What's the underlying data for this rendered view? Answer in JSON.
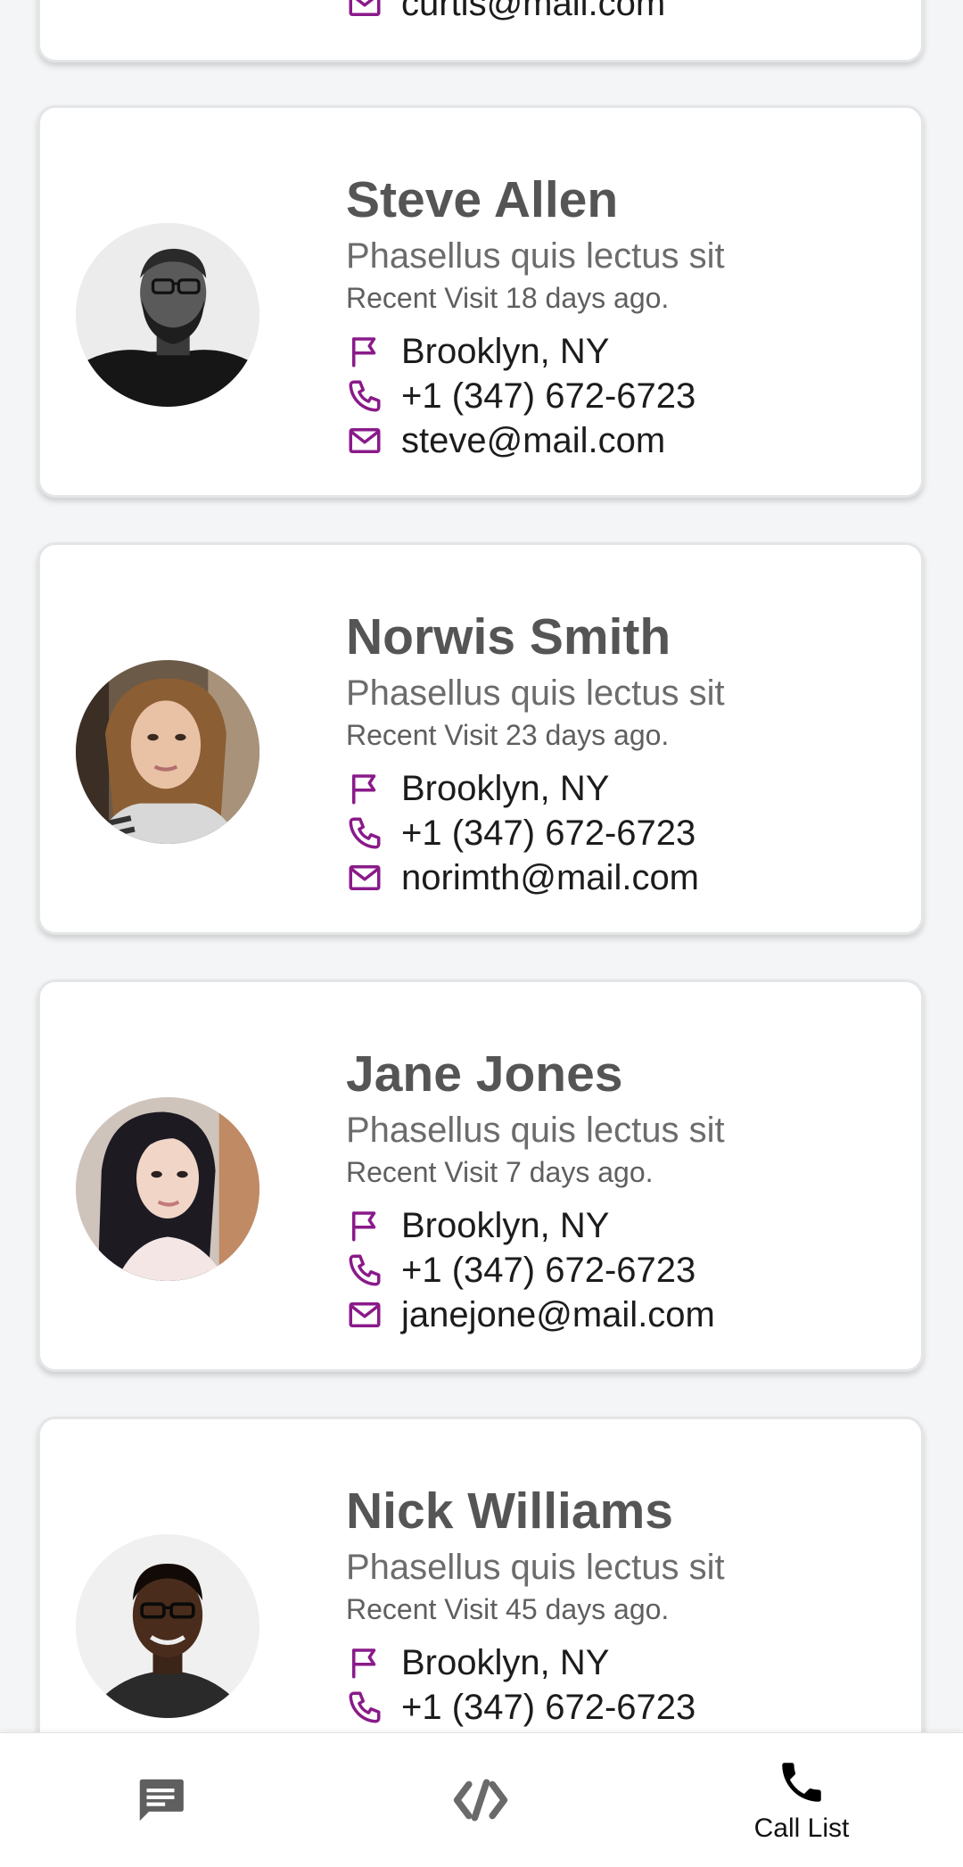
{
  "contacts": [
    {
      "name": "",
      "subtitle": "",
      "visit": "",
      "location": "",
      "phone": "",
      "email": "curtis@mail.com"
    },
    {
      "name": "Steve Allen",
      "subtitle": "Phasellus quis lectus sit",
      "visit": "Recent Visit 18 days ago.",
      "location": "Brooklyn, NY",
      "phone": "+1 (347) 672-6723",
      "email": "steve@mail.com"
    },
    {
      "name": "Norwis Smith",
      "subtitle": "Phasellus quis lectus sit",
      "visit": "Recent Visit 23 days ago.",
      "location": "Brooklyn, NY",
      "phone": "+1 (347) 672-6723",
      "email": "norimth@mail.com"
    },
    {
      "name": "Jane Jones",
      "subtitle": "Phasellus quis lectus sit",
      "visit": "Recent Visit 7 days ago.",
      "location": "Brooklyn, NY",
      "phone": "+1 (347) 672-6723",
      "email": "janejone@mail.com"
    },
    {
      "name": "Nick Williams",
      "subtitle": "Phasellus quis lectus sit",
      "visit": "Recent Visit 45 days ago.",
      "location": "Brooklyn, NY",
      "phone": "+1 (347) 672-6723",
      "email": ""
    }
  ],
  "icons": {
    "location": "flag-icon",
    "phone": "phone-icon",
    "email": "mail-icon"
  },
  "colors": {
    "accent": "#8a1a8a",
    "name_text": "#555555",
    "background": "#f4f5f6"
  },
  "bottom_nav": {
    "items": [
      {
        "icon": "message-icon",
        "label": ""
      },
      {
        "icon": "code-icon",
        "label": ""
      },
      {
        "icon": "phone-icon",
        "label": "Call List"
      }
    ],
    "active_index": 2
  }
}
